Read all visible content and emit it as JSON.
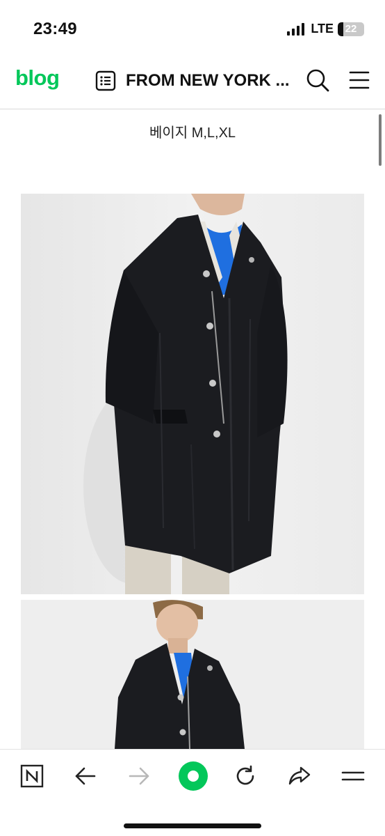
{
  "status_bar": {
    "time": "23:49",
    "network": "LTE",
    "battery_level": "22",
    "battery_fraction": 0.22
  },
  "header": {
    "logo": "blog",
    "title": "FROM NEW YORK ..."
  },
  "content": {
    "caption": "베이지 M,L,XL",
    "images": [
      {
        "icon": "product-photo-black-coat-front"
      },
      {
        "icon": "product-photo-black-coat-side"
      }
    ]
  },
  "toolbar": {
    "buttons": [
      {
        "icon": "naver-n-icon"
      },
      {
        "icon": "back-arrow-icon"
      },
      {
        "icon": "forward-arrow-icon"
      },
      {
        "icon": "naver-green-dot-icon"
      },
      {
        "icon": "refresh-icon"
      },
      {
        "icon": "share-icon"
      },
      {
        "icon": "menu-icon"
      }
    ]
  },
  "colors": {
    "brand_green": "#03c75a",
    "coat": "#1b1c20",
    "shirt_blue": "#1f6fe0",
    "photo_bg": "#eeeeee",
    "disabled": "#b8b8b8"
  }
}
